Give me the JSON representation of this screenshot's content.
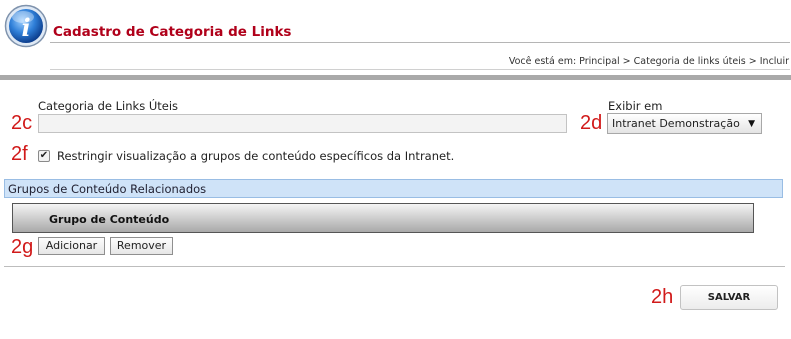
{
  "header": {
    "title": "Cadastro de Categoria de Links",
    "breadcrumb": "Você está em: Principal > Categoria de links úteis > Incluir"
  },
  "form": {
    "category_label": "Categoria de Links Úteis",
    "category_value": "",
    "exibir_label": "Exibir em",
    "exibir_value": "Intranet Demonstração",
    "restrict_label": "Restringir visualização a grupos de conteúdo específicos da Intranet.",
    "restrict_checked": true
  },
  "section": {
    "title": "Grupos de Conteúdo Relacionados",
    "column_header": "Grupo de Conteúdo",
    "add_label": "Adicionar",
    "remove_label": "Remover"
  },
  "save_label": "SALVAR",
  "markers": {
    "m2c": "2c",
    "m2d": "2d",
    "m2f": "2f",
    "m2g": "2g",
    "m2h": "2h"
  },
  "colors": {
    "title": "#b0001a",
    "section_header_bg": "#cfe3f8",
    "marker": "#d11a1a"
  },
  "icons": {
    "logo": "info-icon",
    "select_arrow": "triangle-down-icon",
    "checkbox": "checkmark-icon"
  }
}
